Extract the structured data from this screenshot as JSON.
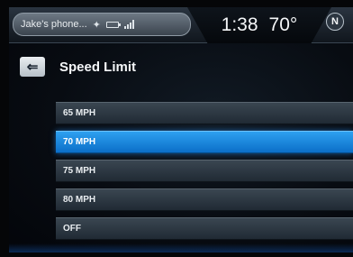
{
  "status_bar": {
    "phone_name": "Jake's phone...",
    "time": "1:38",
    "temperature": "70°",
    "compass_heading": "N",
    "icons": [
      "bluetooth-icon",
      "battery-icon",
      "signal-icon"
    ]
  },
  "header": {
    "back_icon": "back-arrow-icon",
    "title": "Speed Limit"
  },
  "speed_options": [
    {
      "label": "65 MPH",
      "selected": false
    },
    {
      "label": "70 MPH",
      "selected": true
    },
    {
      "label": "75 MPH",
      "selected": false
    },
    {
      "label": "80 MPH",
      "selected": false
    },
    {
      "label": "OFF",
      "selected": false
    }
  ],
  "colors": {
    "selection": "#1a8ae0",
    "list_item": "#2b3642",
    "background": "#080c12"
  }
}
